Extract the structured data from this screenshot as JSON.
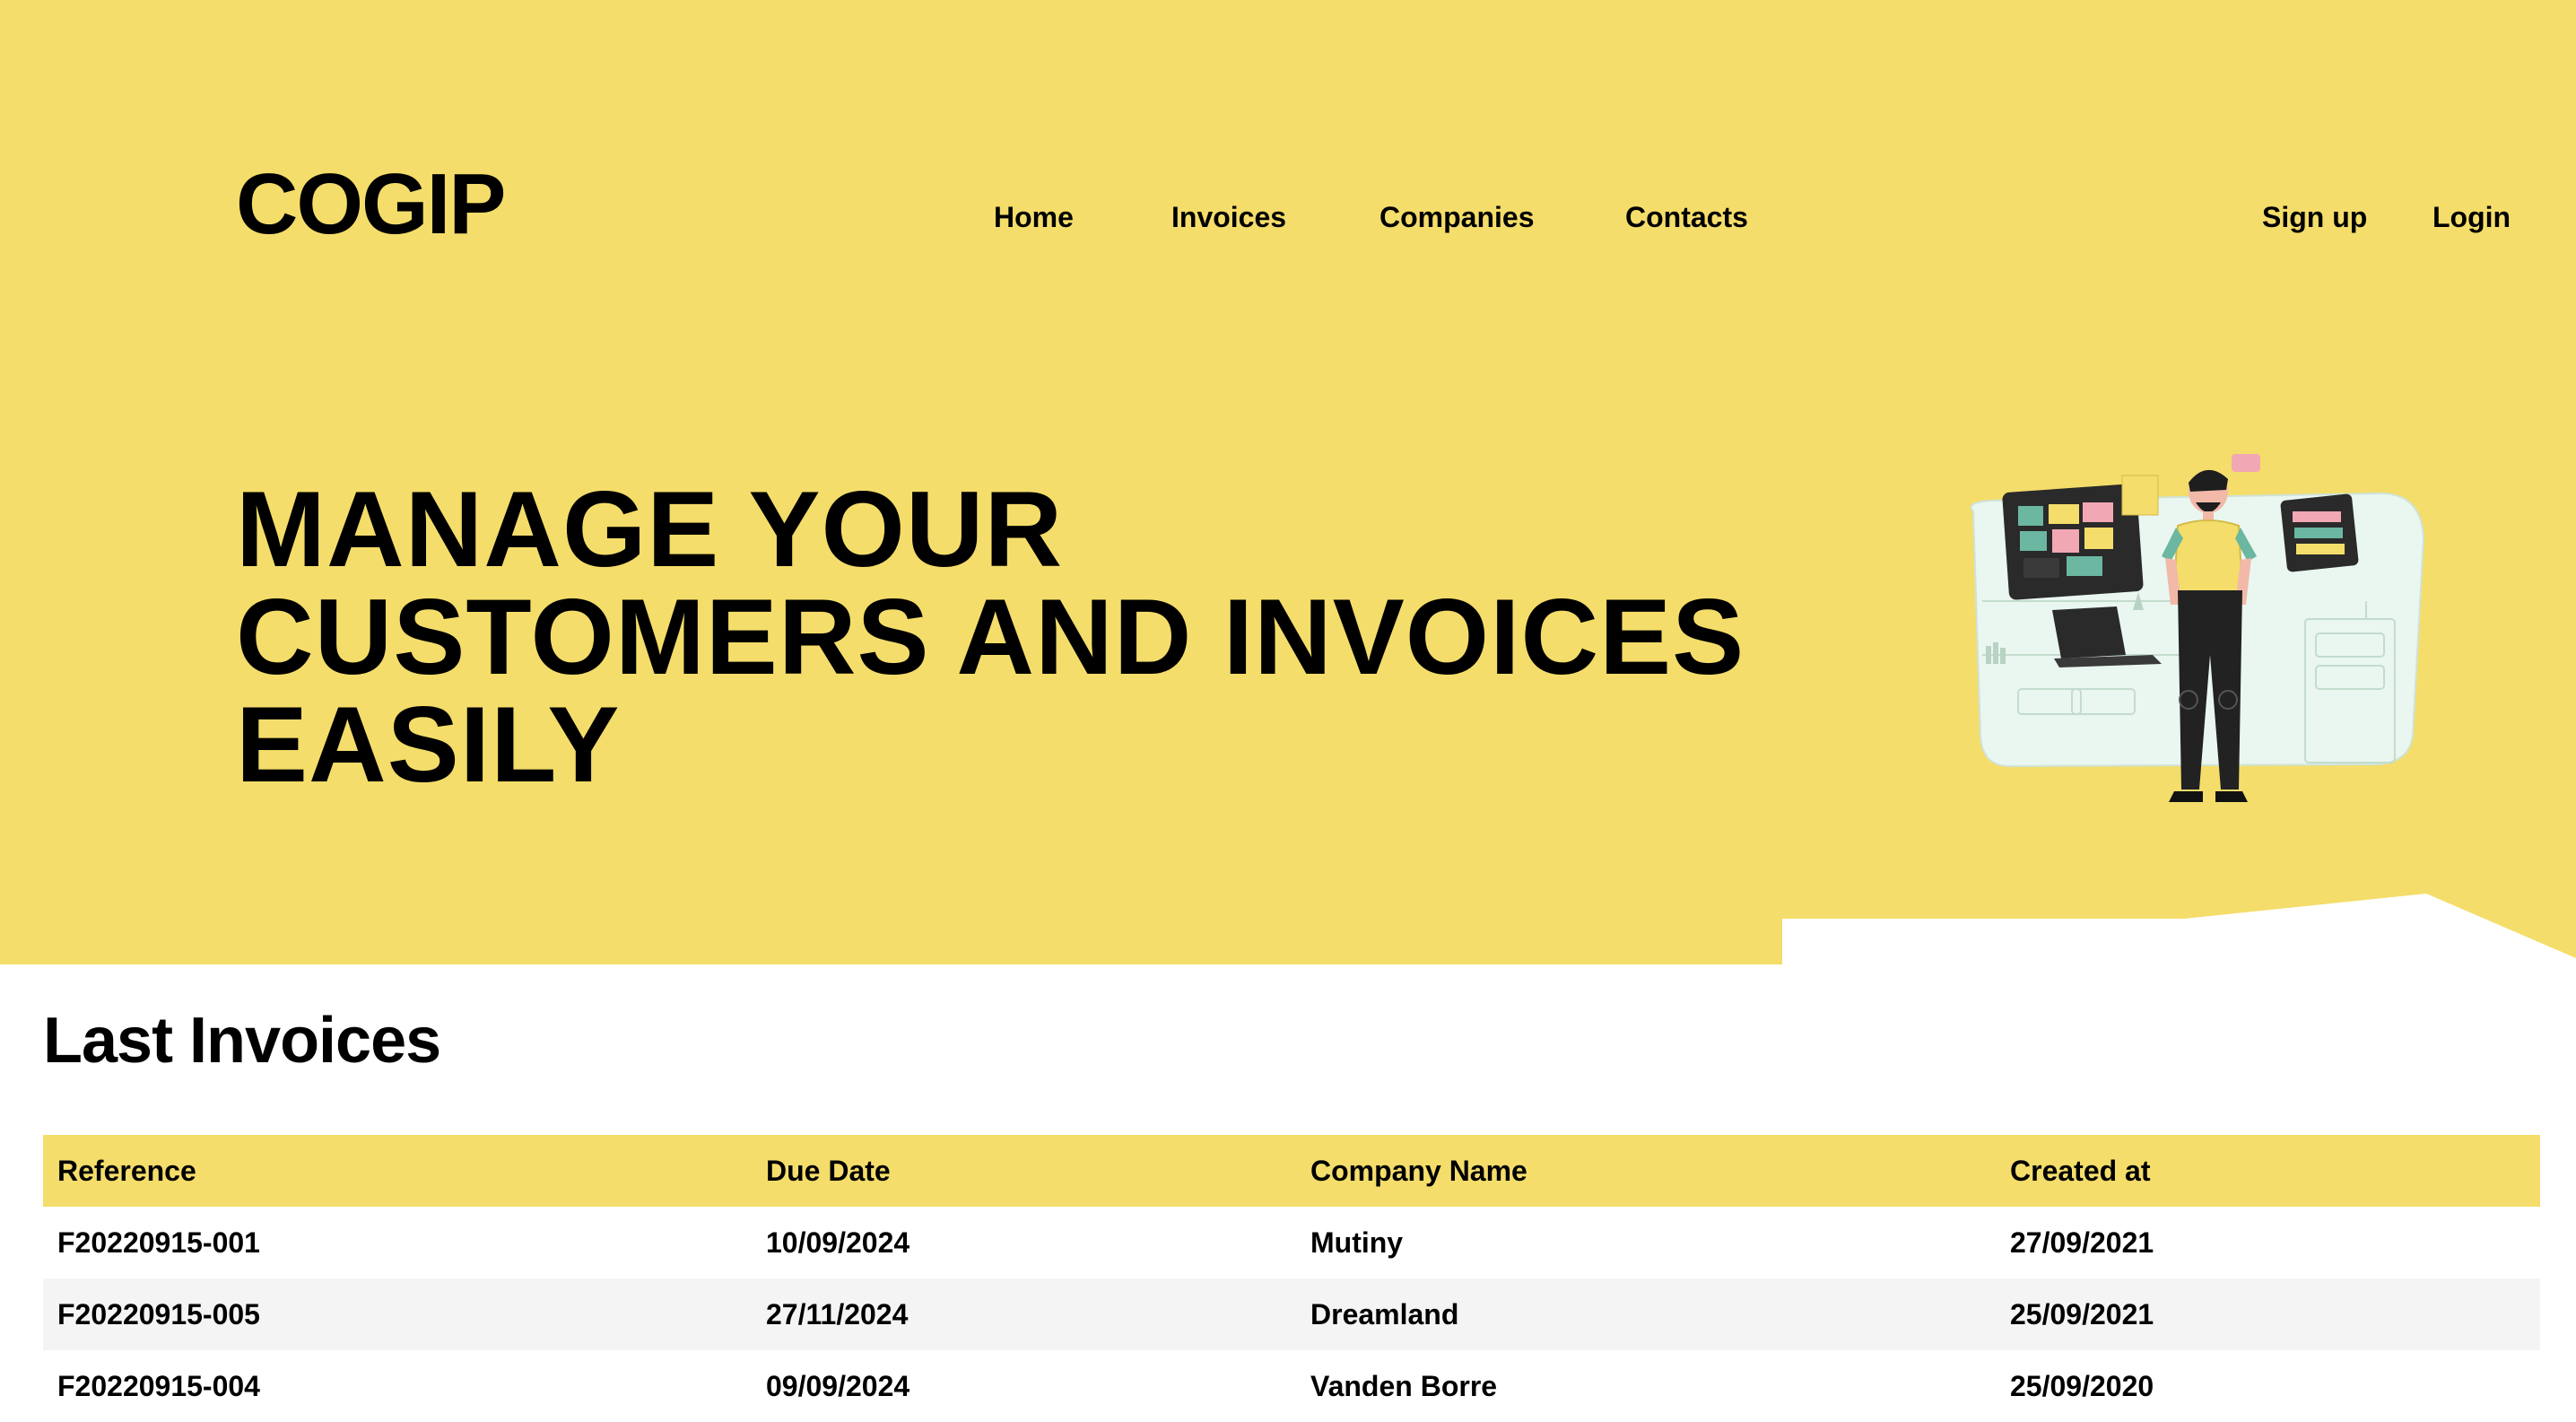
{
  "brand": {
    "name": "COGIP"
  },
  "nav": {
    "items": [
      "Home",
      "Invoices",
      "Companies",
      "Contacts"
    ],
    "signup": "Sign up",
    "login": "Login"
  },
  "hero": {
    "line1": "MANAGE YOUR",
    "line2": "CUSTOMERS AND INVOICES",
    "line3": "EASILY"
  },
  "invoices": {
    "title": "Last Invoices",
    "columns": [
      "Reference",
      "Due Date",
      "Company Name",
      "Created at"
    ],
    "rows": [
      [
        "F20220915-001",
        "10/09/2024",
        "Mutiny",
        "27/09/2021"
      ],
      [
        "F20220915-005",
        "27/11/2024",
        "Dreamland",
        "25/09/2021"
      ],
      [
        "F20220915-004",
        "09/09/2024",
        "Vanden Borre",
        "25/09/2020"
      ]
    ]
  },
  "colors": {
    "brand_yellow": "#f4dd6a",
    "text": "#000000",
    "row_alt": "#f4f4f4",
    "illustration_panel": "#eaf6f0"
  }
}
